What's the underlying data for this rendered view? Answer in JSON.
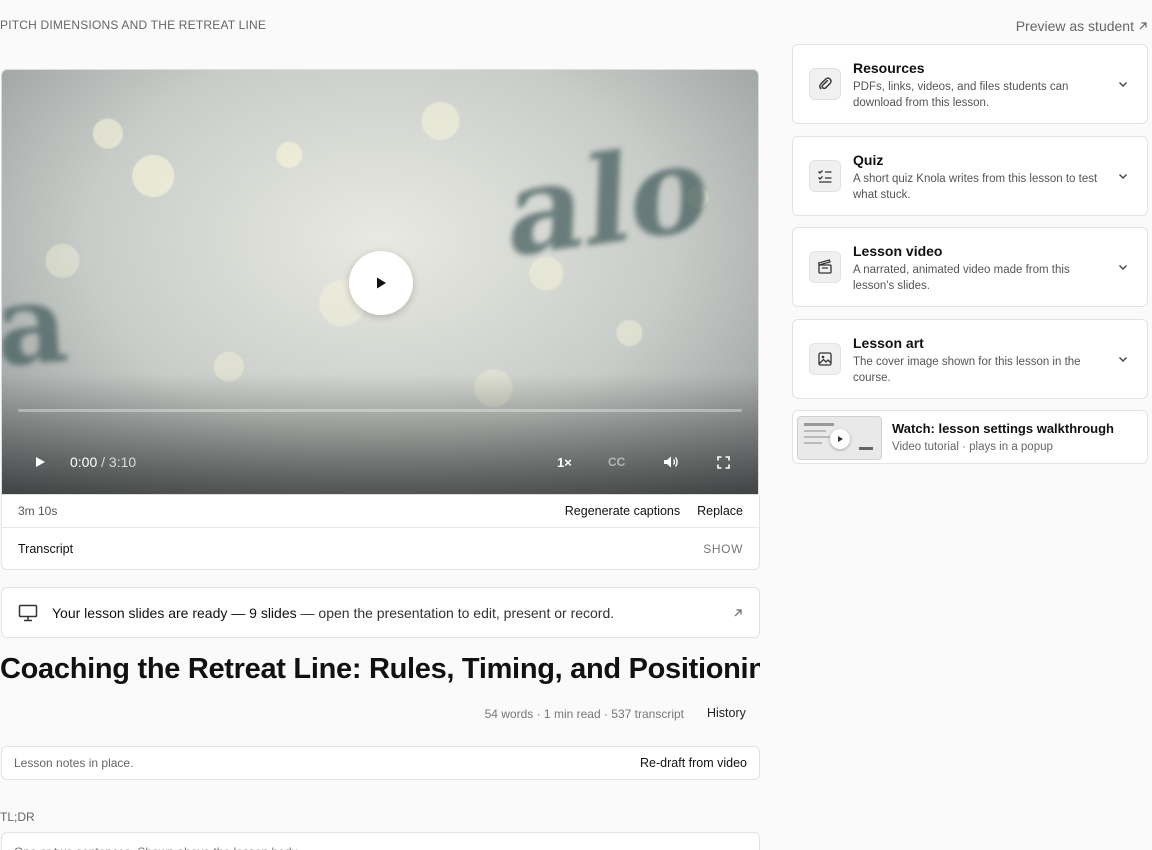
{
  "header": {
    "breadcrumb": "PITCH DIMENSIONS AND THE RETREAT LINE",
    "preview_label": "Preview as student"
  },
  "video": {
    "current_time": "0:00",
    "separator": " / ",
    "duration": "3:10",
    "speed": "1×",
    "cc": "CC",
    "progress": 0
  },
  "video_meta": {
    "length": "3m 10s",
    "regenerate_label": "Regenerate captions",
    "replace_label": "Replace",
    "transcript_label": "Transcript",
    "show_label": "SHOW"
  },
  "slides_banner": {
    "prefix": "Your lesson slides are ready — 9 slides",
    "suffix": " — open the presentation to edit, present or record."
  },
  "lesson": {
    "title": "Coaching the Retreat Line: Rules, Timing, and Positioning",
    "stats": "54 words · 1 min read · 537 transcript",
    "history_label": "History"
  },
  "notes": {
    "status": "Lesson notes in place.",
    "redraft_label": "Re-draft from video"
  },
  "tldr": {
    "label": "TL;DR",
    "placeholder": "One or two sentences. Shown above the lesson body."
  },
  "panels": [
    {
      "title": "Resources",
      "desc": "PDFs, links, videos, and files students can download from this lesson.",
      "icon": "paperclip-icon"
    },
    {
      "title": "Quiz",
      "desc": "A short quiz Knola writes from this lesson to test what stuck.",
      "icon": "checklist-icon"
    },
    {
      "title": "Lesson video",
      "desc": "A narrated, animated video made from this lesson's slides.",
      "icon": "clapperboard-icon"
    },
    {
      "title": "Lesson art",
      "desc": "The cover image shown for this lesson in the course.",
      "icon": "image-icon"
    }
  ],
  "tutorial": {
    "title": "Watch: lesson settings walkthrough",
    "subtitle": "Video tutorial · plays in a popup"
  }
}
